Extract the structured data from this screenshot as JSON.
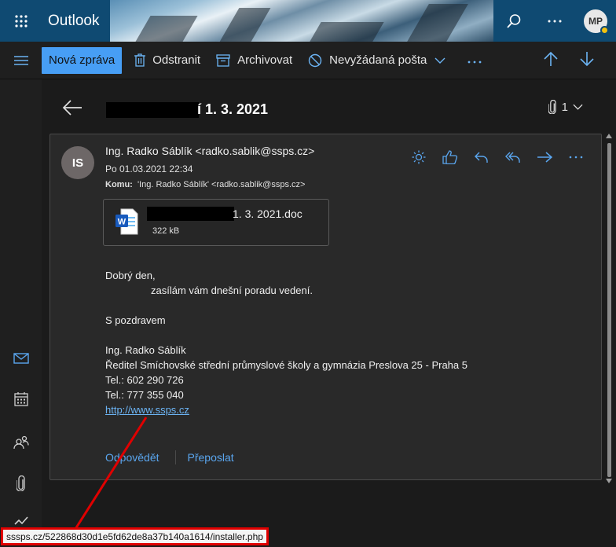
{
  "app": {
    "name": "Outlook",
    "user_initials": "MP"
  },
  "toolbar": {
    "new_mail": "Nová zpráva",
    "delete": "Odstranit",
    "archive": "Archivovat",
    "junk": "Nevyžádaná pošta"
  },
  "message": {
    "subject_tail": "í 1. 3. 2021",
    "attachment_count": "1",
    "sender_initials": "IS",
    "from": "Ing. Radko Sáblík <radko.sablik@ssps.cz>",
    "date": "Po 01.03.2021 22:34",
    "to_label": "Komu:",
    "to_value": "'Ing. Radko Sáblík' <radko.sablik@ssps.cz>",
    "attachment": {
      "name_tail": "1. 3. 2021.doc",
      "size": "322 kB"
    },
    "body": {
      "greeting": "Dobrý den,",
      "line1": "zasílám vám dnešní poradu vedení.",
      "closing": "S pozdravem",
      "sig_name": "Ing. Radko Sáblík",
      "sig_title": "Ředitel Smíchovské střední průmyslové školy a gymnázia Preslova 25 - Praha 5",
      "sig_tel1": "Tel.: 602 290 726",
      "sig_tel2": "Tel.: 777 355 040",
      "link": "http://www.ssps.cz"
    },
    "reply": "Odpovědět",
    "forward": "Přeposlat"
  },
  "status": {
    "hover_url": "sssps.cz/522868d30d1e5fd62de8a37b140a1614/installer.php"
  },
  "colors": {
    "accent": "#479ef5",
    "header": "#0f4a72",
    "annotation": "#e00000"
  }
}
